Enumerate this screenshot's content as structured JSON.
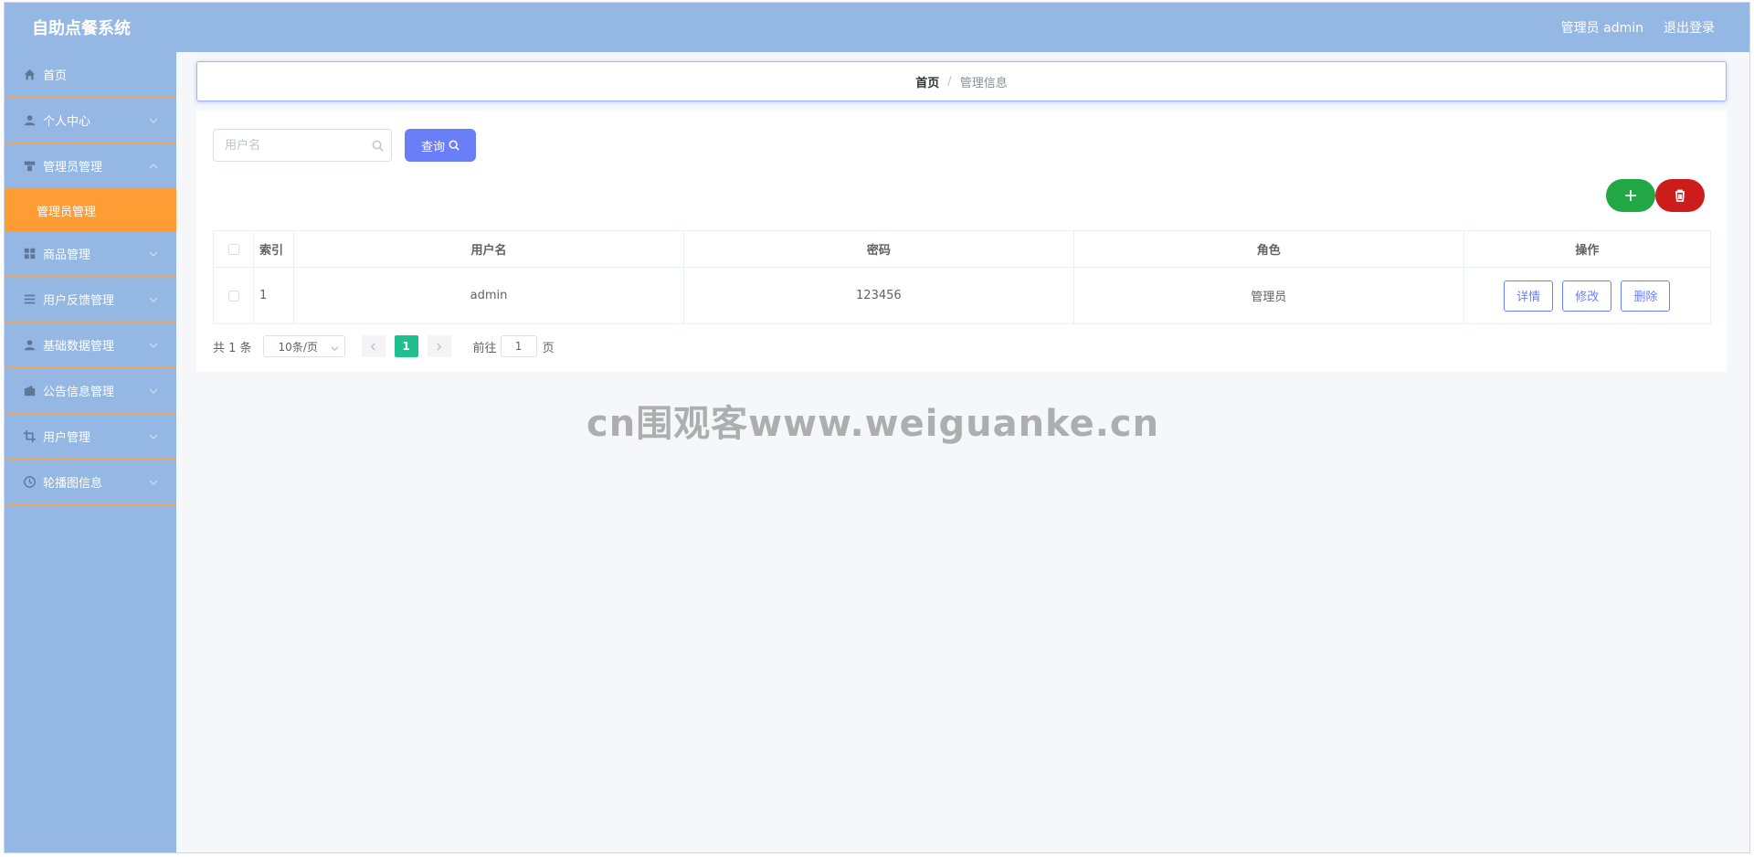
{
  "header": {
    "title": "自助点餐系统",
    "user_label": "管理员 admin",
    "logout_label": "退出登录"
  },
  "sidebar": {
    "items": [
      {
        "label": "首页",
        "icon": "home-icon"
      },
      {
        "label": "个人中心",
        "icon": "user-icon"
      },
      {
        "label": "管理员管理",
        "icon": "admin-icon",
        "expanded": true
      },
      {
        "label": "商品管理",
        "icon": "grid-icon"
      },
      {
        "label": "用户反馈管理",
        "icon": "list-icon"
      },
      {
        "label": "基础数据管理",
        "icon": "user-icon"
      },
      {
        "label": "公告信息管理",
        "icon": "wallet-icon"
      },
      {
        "label": "用户管理",
        "icon": "crop-icon"
      },
      {
        "label": "轮播图信息",
        "icon": "clock-icon"
      }
    ],
    "active_sub": "管理员管理",
    "accent_color": "#ff9c33",
    "bg_color": "#94b7e4"
  },
  "breadcrumb": {
    "home": "首页",
    "separator": "/",
    "current": "管理信息"
  },
  "search": {
    "placeholder": "用户名",
    "value": "",
    "button_label": "查询"
  },
  "table": {
    "columns": [
      "索引",
      "用户名",
      "密码",
      "角色",
      "操作"
    ],
    "rows": [
      {
        "index": "1",
        "username": "admin",
        "password": "123456",
        "role": "管理员"
      }
    ],
    "actions": [
      "详情",
      "修改",
      "删除"
    ]
  },
  "pagination": {
    "total": "共 1 条",
    "page_size": "10条/页",
    "current_page": "1",
    "goto_label": "前往",
    "goto_value": "1",
    "page_suffix": "页"
  },
  "watermark": "cn围观客www.weiguanke.cn"
}
